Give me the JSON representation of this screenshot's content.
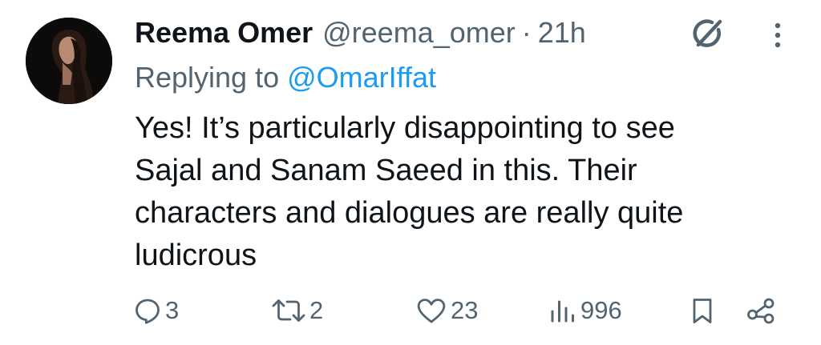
{
  "tweet": {
    "author": {
      "display_name": "Reema Omer",
      "handle": "@reema_omer"
    },
    "separator": "·",
    "timestamp": "21h",
    "reply_prefix": "Replying to",
    "reply_to": "@OmarIffat",
    "text_lines": [
      "Yes! It’s particularly disappointing to see",
      "Sajal and Sanam Saeed in this. Their",
      "characters and dialogues are really quite",
      "ludicrous"
    ]
  },
  "actions": {
    "replies": "3",
    "reposts": "2",
    "likes": "23",
    "views": "996"
  },
  "icons": {
    "header": [
      "grok-icon",
      "more-vertical-icon"
    ],
    "actions": [
      "reply-icon",
      "repost-icon",
      "like-icon",
      "views-icon",
      "bookmark-icon",
      "share-icon"
    ]
  },
  "colors": {
    "text_primary": "#0f1419",
    "text_secondary": "#536471",
    "link": "#1d9bf0",
    "background": "#ffffff"
  }
}
